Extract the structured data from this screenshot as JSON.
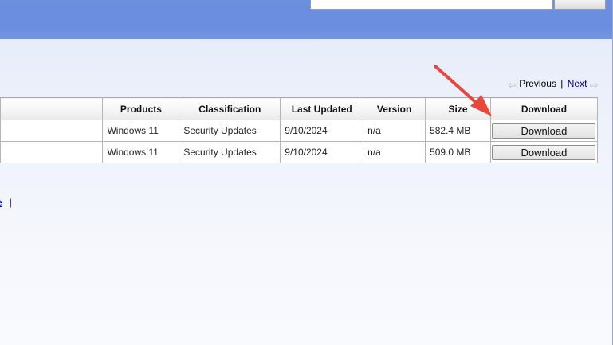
{
  "pager": {
    "previous": "Previous",
    "separator": "|",
    "next": "Next"
  },
  "table": {
    "headers": {
      "products": "Products",
      "classification": "Classification",
      "last_updated": "Last Updated",
      "version": "Version",
      "size": "Size",
      "download": "Download"
    },
    "rows": [
      {
        "products": "Windows 11",
        "classification": "Security Updates",
        "last_updated": "9/10/2024",
        "version": "n/a",
        "size": "582.4 MB",
        "download_label": "Download"
      },
      {
        "products": "Windows 11",
        "classification": "Security Updates",
        "last_updated": "9/10/2024",
        "version": "n/a",
        "size": "509.0 MB",
        "download_label": "Download"
      }
    ]
  },
  "left": {
    "link_fragment": "e",
    "separator": "|"
  },
  "colors": {
    "header_band": "#6a8ddf",
    "annotation_arrow": "#e8473b",
    "link": "#00008b"
  }
}
